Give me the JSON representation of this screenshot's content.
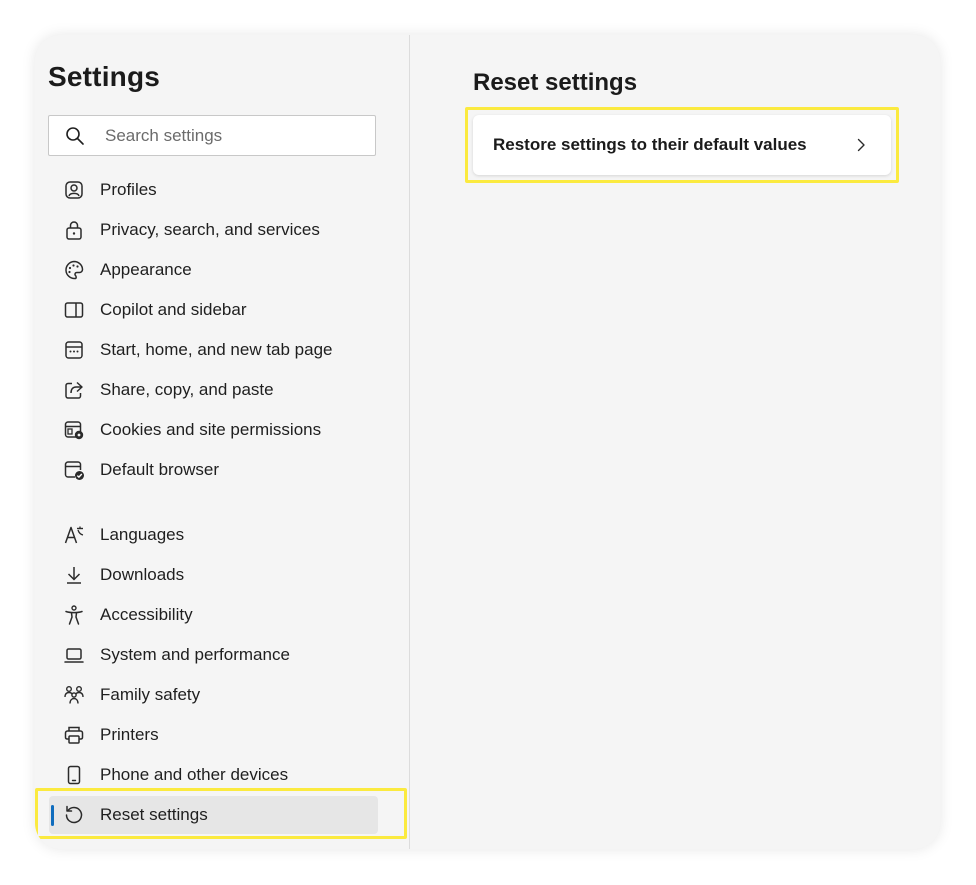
{
  "sidebar": {
    "title": "Settings",
    "search": {
      "placeholder": "Search settings",
      "value": ""
    },
    "items": [
      {
        "label": "Profiles",
        "icon": "profile-icon"
      },
      {
        "label": "Privacy, search, and services",
        "icon": "lock-icon"
      },
      {
        "label": "Appearance",
        "icon": "palette-icon"
      },
      {
        "label": "Copilot and sidebar",
        "icon": "sidebar-icon"
      },
      {
        "label": "Start, home, and new tab page",
        "icon": "new-tab-icon"
      },
      {
        "label": "Share, copy, and paste",
        "icon": "share-icon"
      },
      {
        "label": "Cookies and site permissions",
        "icon": "cookie-settings-icon"
      },
      {
        "label": "Default browser",
        "icon": "default-browser-icon"
      },
      {
        "label": "Languages",
        "icon": "languages-icon"
      },
      {
        "label": "Downloads",
        "icon": "download-icon"
      },
      {
        "label": "Accessibility",
        "icon": "accessibility-icon"
      },
      {
        "label": "System and performance",
        "icon": "laptop-icon"
      },
      {
        "label": "Family safety",
        "icon": "family-icon"
      },
      {
        "label": "Printers",
        "icon": "printer-icon"
      },
      {
        "label": "Phone and other devices",
        "icon": "phone-icon"
      },
      {
        "label": "Reset settings",
        "icon": "reset-icon",
        "active": true
      }
    ]
  },
  "main": {
    "title": "Reset settings",
    "restore_label": "Restore settings to their default values"
  },
  "colors": {
    "highlight": "#fbea3f",
    "accent": "#0f6cbd",
    "active_bg": "#e6e6e6"
  }
}
